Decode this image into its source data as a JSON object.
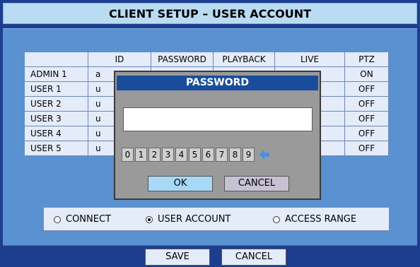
{
  "title": "CLIENT SETUP – USER ACCOUNT",
  "table": {
    "headers": [
      "",
      "ID",
      "PASSWORD",
      "PLAYBACK",
      "LIVE",
      "PTZ"
    ],
    "rows": [
      {
        "name": "ADMIN 1",
        "id": "a",
        "ptz": "ON"
      },
      {
        "name": "USER 1",
        "id": "u",
        "ptz": "OFF"
      },
      {
        "name": "USER 2",
        "id": "u",
        "ptz": "OFF"
      },
      {
        "name": "USER 3",
        "id": "u",
        "ptz": "OFF"
      },
      {
        "name": "USER 4",
        "id": "u",
        "ptz": "OFF"
      },
      {
        "name": "USER 5",
        "id": "u",
        "ptz": "OFF"
      }
    ]
  },
  "dialog": {
    "title": "PASSWORD",
    "input_value": "",
    "keys": [
      "0",
      "1",
      "2",
      "3",
      "4",
      "5",
      "6",
      "7",
      "8",
      "9"
    ],
    "ok_label": "OK",
    "cancel_label": "CANCEL"
  },
  "modes": {
    "connect": "CONNECT",
    "user_account": "USER ACCOUNT",
    "access_range": "ACCESS RANGE",
    "selected": "user_account"
  },
  "footer": {
    "save_label": "SAVE",
    "cancel_label": "CANCEL"
  }
}
